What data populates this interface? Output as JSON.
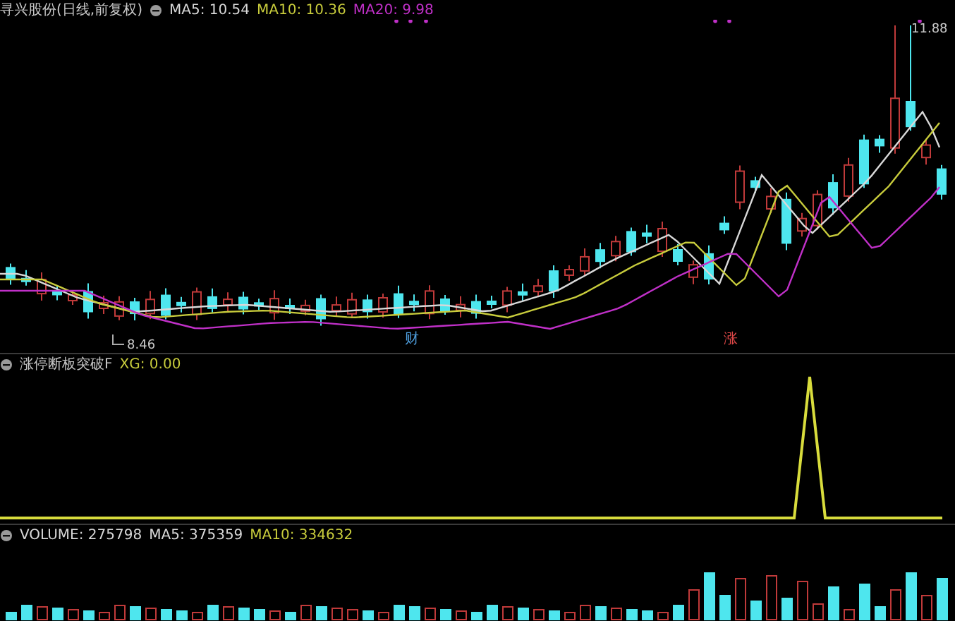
{
  "main_chart": {
    "title": "寻兴股份(日线,前复权)",
    "indicators": [
      {
        "text": "MA5: 10.54",
        "color": "#d8d8d8"
      },
      {
        "text": "MA10: 10.36",
        "color": "#c8cc3c"
      },
      {
        "text": "MA20: 9.98",
        "color": "#c030c8"
      }
    ],
    "high_label": "11.88",
    "low_label": "8.46",
    "signals": [
      {
        "text": "财",
        "color": "#4fa0e0"
      },
      {
        "text": "涨",
        "color": "#e04848"
      }
    ]
  },
  "signal_panel": {
    "title": "涨停断板突破F",
    "indicators": [
      {
        "text": "XG: 0.00",
        "color": "#c8cc3c"
      }
    ]
  },
  "volume_panel": {
    "indicators": [
      {
        "text": "VOLUME: 275798",
        "color": "#d8d8d8"
      },
      {
        "text": "MA5: 375359",
        "color": "#d8d8d8"
      },
      {
        "text": "MA10: 334632",
        "color": "#c8cc3c"
      }
    ]
  }
}
